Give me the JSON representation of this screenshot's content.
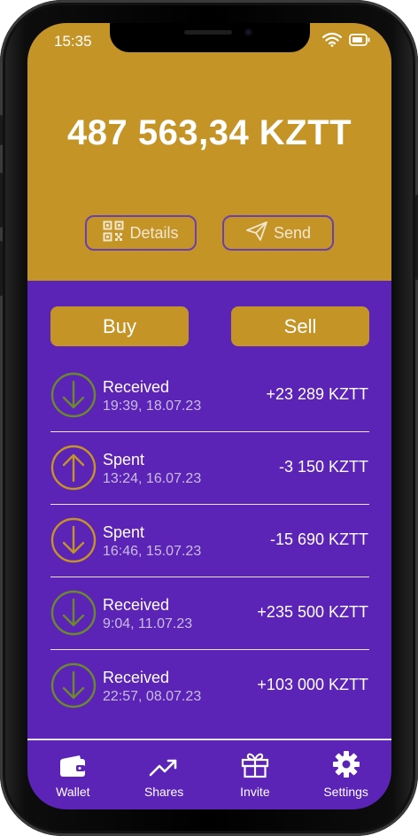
{
  "status_bar": {
    "time": "15:35",
    "icons": [
      "wifi-icon",
      "battery-icon"
    ]
  },
  "wallet": {
    "balance": "487 563,34 KZTT",
    "details_label": "Details",
    "send_label": "Send"
  },
  "actions": {
    "buy_label": "Buy",
    "sell_label": "Sell"
  },
  "transactions": [
    {
      "type": "Received",
      "date": "19:39, 18.07.23",
      "amount": "+23 289 KZTT",
      "direction": "in"
    },
    {
      "type": "Spent",
      "date": "13:24, 16.07.23",
      "amount": "-3 150 KZTT",
      "direction": "out"
    },
    {
      "type": "Spent",
      "date": "16:46, 15.07.23",
      "amount": "-15 690 KZTT",
      "direction": "in"
    },
    {
      "type": "Received",
      "date": "9:04, 11.07.23",
      "amount": "+235 500 KZTT",
      "direction": "in"
    },
    {
      "type": "Received",
      "date": "22:57, 08.07.23",
      "amount": "+103 000 KZTT",
      "direction": "in"
    }
  ],
  "nav": [
    {
      "label": "Wallet",
      "icon": "wallet-icon"
    },
    {
      "label": "Shares",
      "icon": "trend-icon"
    },
    {
      "label": "Invite",
      "icon": "gift-icon"
    },
    {
      "label": "Settings",
      "icon": "gear-icon"
    }
  ],
  "colors": {
    "gold": "#c49426",
    "purple": "#5b24b6",
    "received_icon": "#6b8a2e",
    "spent_icon": "#c49426"
  }
}
